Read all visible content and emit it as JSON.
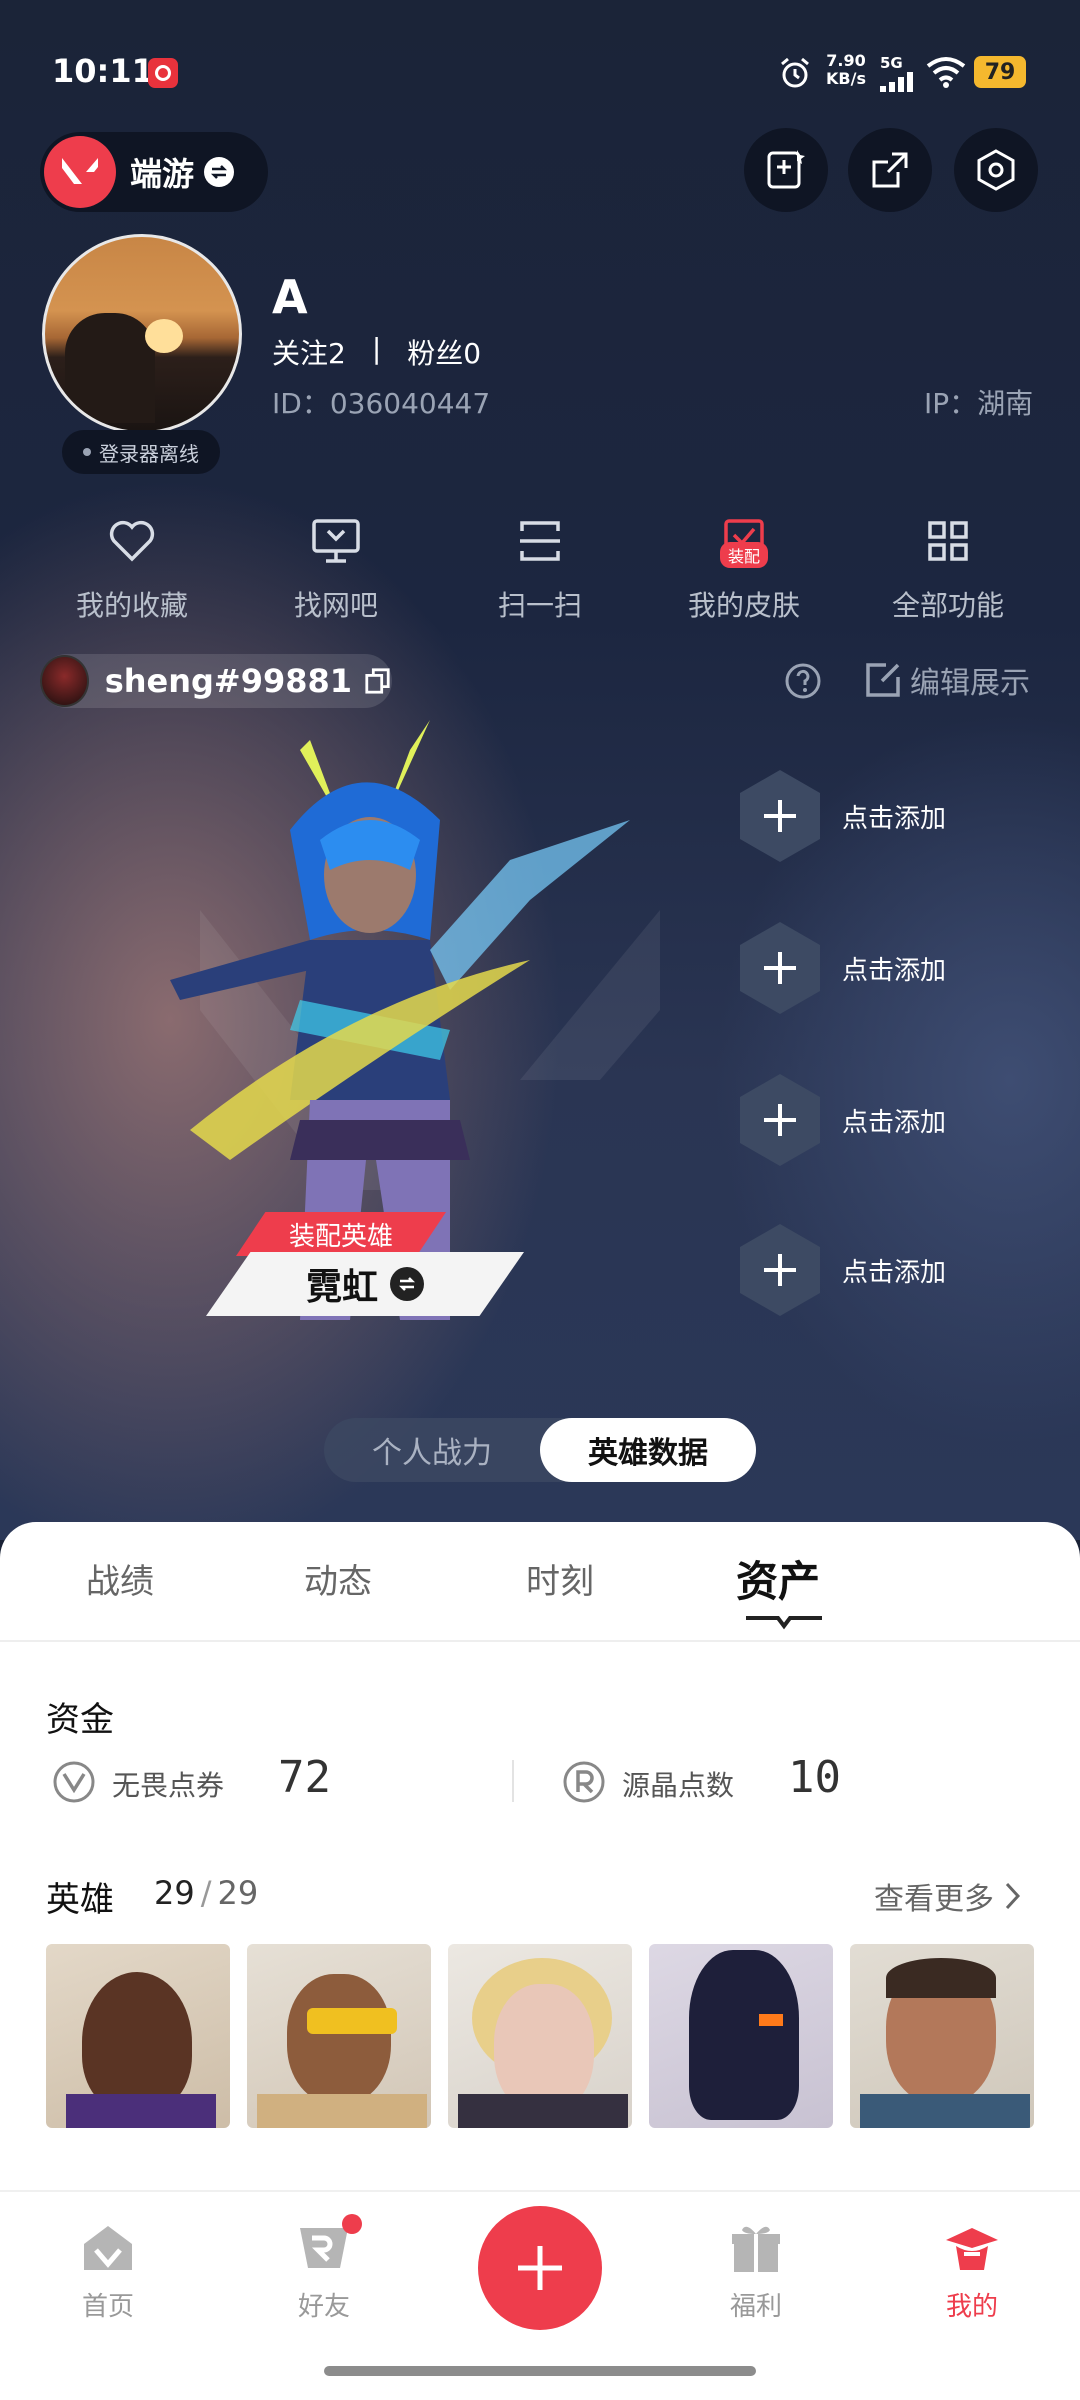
{
  "status_bar": {
    "time": "10:11",
    "net_speed_top": "7.90",
    "net_speed_bottom": "KB/s",
    "signal": "5G",
    "battery": "79"
  },
  "header": {
    "mode_label": "端游"
  },
  "profile": {
    "name": "A",
    "follow": "关注2",
    "separator": "|",
    "fans": "粉丝0",
    "id": "ID：036040447",
    "ip": "IP：湖南",
    "status": "登录器离线"
  },
  "functions": [
    {
      "label": "我的收藏",
      "icon": "heart-icon"
    },
    {
      "label": "找网吧",
      "icon": "monitor-icon"
    },
    {
      "label": "扫一扫",
      "icon": "scan-icon"
    },
    {
      "label": "我的皮肤",
      "icon": "skin-icon",
      "badge": "装配"
    },
    {
      "label": "全部功能",
      "icon": "grid-icon"
    }
  ],
  "account": {
    "riot_id": "sheng#99881",
    "edit_label": "编辑展示"
  },
  "showcase": {
    "equip_tag": "装配英雄",
    "agent_name": "霓虹",
    "slots": [
      "点击添加",
      "点击添加",
      "点击添加",
      "点击添加"
    ]
  },
  "toggle": {
    "left": "个人战力",
    "right": "英雄数据",
    "active": "right"
  },
  "tabs": {
    "items": [
      "战绩",
      "动态",
      "时刻",
      "资产"
    ],
    "active": 3
  },
  "assets": {
    "funds_title": "资金",
    "vp_label": "无畏点券",
    "vp_value": "72",
    "rp_label": "源晶点数",
    "rp_value": "10",
    "heroes_title": "英雄",
    "heroes_owned": "29",
    "heroes_sep": "/",
    "heroes_total": "29",
    "more_label": "查看更多"
  },
  "bottom_nav": {
    "items": [
      "首页",
      "好友",
      "福利",
      "我的"
    ],
    "active": 3
  },
  "colors": {
    "accent": "#ee3d4c",
    "sheet": "#ffffff",
    "battery": "#f5b82e"
  }
}
